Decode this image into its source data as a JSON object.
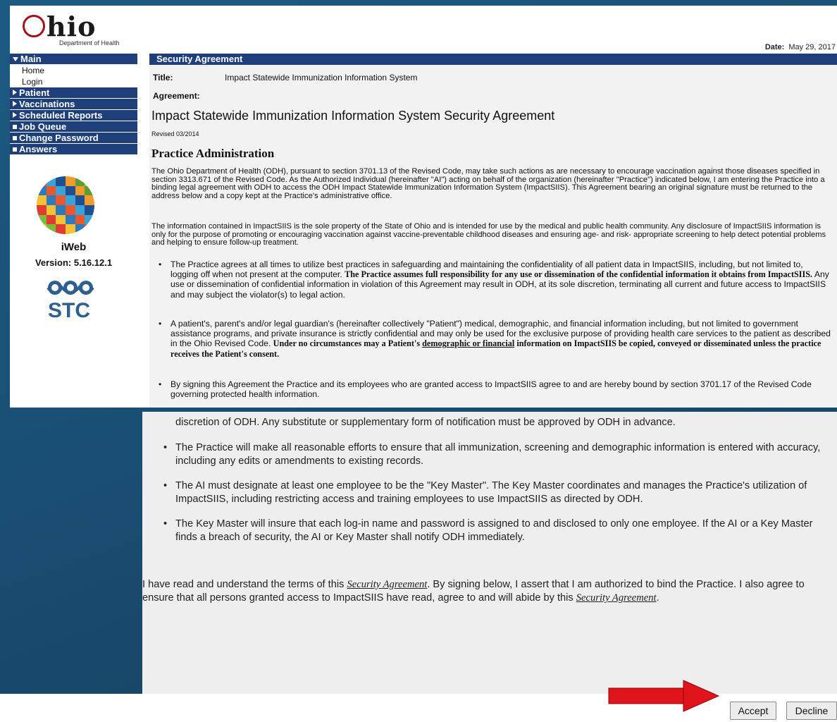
{
  "header": {
    "logo_text": "Ohio",
    "logo_subtitle": "Department of Health",
    "date_label": "Date:",
    "date_value": "May 29, 2017"
  },
  "sidebar": {
    "items": [
      {
        "label": "Main",
        "type": "header",
        "marker": "tri-down"
      },
      {
        "label": "Home",
        "type": "sub"
      },
      {
        "label": "Login",
        "type": "sub"
      },
      {
        "label": "Patient",
        "type": "header",
        "marker": "tri-right"
      },
      {
        "label": "Vaccinations",
        "type": "header",
        "marker": "tri-right"
      },
      {
        "label": "Scheduled Reports",
        "type": "header",
        "marker": "tri-right"
      },
      {
        "label": "Job Queue",
        "type": "header",
        "marker": "square"
      },
      {
        "label": "Change Password",
        "type": "header",
        "marker": "square"
      },
      {
        "label": "Answers",
        "type": "header",
        "marker": "square"
      }
    ],
    "product_name": "iWeb",
    "version_text": "Version: 5.16.12.1",
    "vendor_logo_text": "STC"
  },
  "main": {
    "section_title": "Security Agreement",
    "title_label": "Title:",
    "title_value": "Impact Statewide Immunization Information System",
    "agreement_label": "Agreement:",
    "agreement_title": "Impact Statewide Immunization Information System Security Agreement",
    "revised": "Revised 03/2014",
    "heading": "Practice Administration",
    "para1": "The Ohio Department of Health (ODH), pursuant to section 3701.13 of the Revised Code, may take such actions as are necessary to encourage vaccination against those diseases specified in section 3313.671 of the Revised Code. As the Authorized Individual (hereinafter \"AI\") acting on behalf of the organization (hereinafter \"Practice\") indicated below, I am entering the Practice into a binding legal agreement with ODH to access the ODH Impact Statewide Immunization Information System (ImpactSIIS). This Agreement bearing an original signature must be returned to the address below and a copy kept at the Practice's administrative office.",
    "para2": "The information contained in ImpactSIIS is the sole property of the State of Ohio and is intended for use by the medical and public health community. Any disclosure of ImpactSIIS information is only for the purpose of promoting or encouraging vaccination against vaccine-preventable childhood diseases and ensuring age- and risk- appropriate screening to help detect potential problems and helping to ensure follow-up treatment.",
    "bullet1_a": "The Practice agrees at all times to utilize best practices in safeguarding and maintaining the confidentiality of all patient data in ImpactSIIS, including, but not limited to, logging off when not present at the computer.",
    "bullet1_b": "The Practice assumes full responsibility for any use or dissemination of the confidential information it obtains from ImpactSIIS.",
    "bullet1_c": "Any use or dissemination of confidential information in violation of this Agreement may result in ODH, at its sole discretion, terminating all current and future access to ImpactSIIS and may subject the violator(s) to legal action.",
    "bullet2_a": "A patient's, parent's and/or legal guardian's (hereinafter collectively \"Patient\") medical, demographic, and financial information including, but not limited to government assistance programs, and private insurance is strictly confidential and may only be used for the exclusive purpose of providing health care services to the patient as described in the Ohio Revised Code.",
    "bullet2_b": "Under no circumstances may a Patient's",
    "bullet2_u": "demographic or financial",
    "bullet2_c": "information on ImpactSIIS be copied, conveyed or disseminated unless the practice receives the Patient's consent.",
    "bullet3": "By signing this Agreement the Practice and its employees who are granted access to ImpactSIIS agree to and are hereby bound by section 3701.17 of the Revised Code governing protected health information."
  },
  "lower": {
    "cont_line": "discretion of ODH. Any substitute or supplementary form of notification must be approved by ODH in advance.",
    "bullet4": "The Practice will make all reasonable efforts to ensure that all immunization, screening and demographic information is entered with accuracy, including any edits or amendments to existing records.",
    "bullet5": "The AI must designate at least one employee to be the \"Key Master\". The Key Master coordinates and manages the Practice's utilization of ImpactSIIS, including restricting access and training employees to use ImpactSIIS as directed by ODH.",
    "bullet6": "The Key Master will insure that each log-in name and password is assigned to and disclosed to only one employee. If the AI or a Key Master finds a breach of security, the AI or Key Master shall notify ODH immediately.",
    "ack_1": "I have read and understand the terms of this",
    "ack_link1": "Security Agreement",
    "ack_2": ". By signing below, I assert that I am authorized to bind the Practice. I also agree to ensure that all persons granted access to ImpactSIIS have read, agree to and will abide by this",
    "ack_link2": "Security Agreement",
    "ack_3": "."
  },
  "buttons": {
    "accept": "Accept",
    "decline": "Decline"
  },
  "colors": {
    "nav_blue": "#1f3f7a",
    "ohio_red": "#a3121b",
    "arrow_red": "#e0141b",
    "background": "#1a4f74"
  },
  "icons": {
    "arrow": "red-arrow-right-icon",
    "menu_open": "triangle-down-icon",
    "menu_closed": "triangle-right-icon",
    "menu_item": "square-bullet-icon"
  }
}
